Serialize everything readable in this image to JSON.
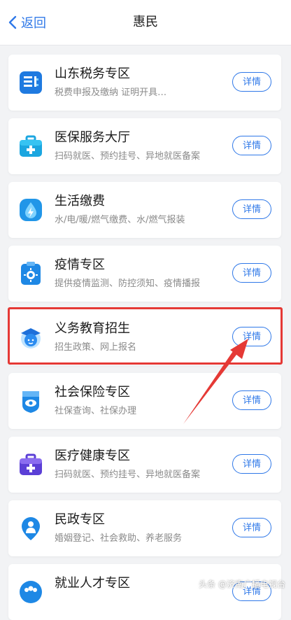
{
  "header": {
    "back_label": "返回",
    "title": "惠民"
  },
  "services": [
    {
      "name": "山东税务专区",
      "desc": "税费申报及缴纳  证明开具…",
      "button": "详情",
      "icon": "tax-icon"
    },
    {
      "name": "医保服务大厅",
      "desc": "扫码就医、预约挂号、异地就医备案",
      "button": "详情",
      "icon": "medical-kit-icon"
    },
    {
      "name": "生活缴费",
      "desc": "水/电/暖/燃气缴费、水/燃气报装",
      "button": "详情",
      "icon": "water-drop-icon"
    },
    {
      "name": "疫情专区",
      "desc": "提供疫情监测、防控须知、疫情播报",
      "button": "详情",
      "icon": "virus-clipboard-icon"
    },
    {
      "name": "义务教育招生",
      "desc": "招生政策、网上报名",
      "button": "详情",
      "icon": "student-icon"
    },
    {
      "name": "社会保险专区",
      "desc": "社保查询、社保办理",
      "button": "详情",
      "icon": "shield-eye-icon"
    },
    {
      "name": "医疗健康专区",
      "desc": "扫码就医、预约挂号、异地就医备案",
      "button": "详情",
      "icon": "medical-case-icon"
    },
    {
      "name": "民政专区",
      "desc": "婚姻登记、社会救助、养老服务",
      "button": "详情",
      "icon": "person-location-icon"
    },
    {
      "name": "就业人才专区",
      "desc": "",
      "button": "详情",
      "icon": "people-icon"
    }
  ],
  "watermark": "头条 @济南广播电视台",
  "colors": {
    "accent": "#2f78e8",
    "highlight": "#e53935"
  }
}
